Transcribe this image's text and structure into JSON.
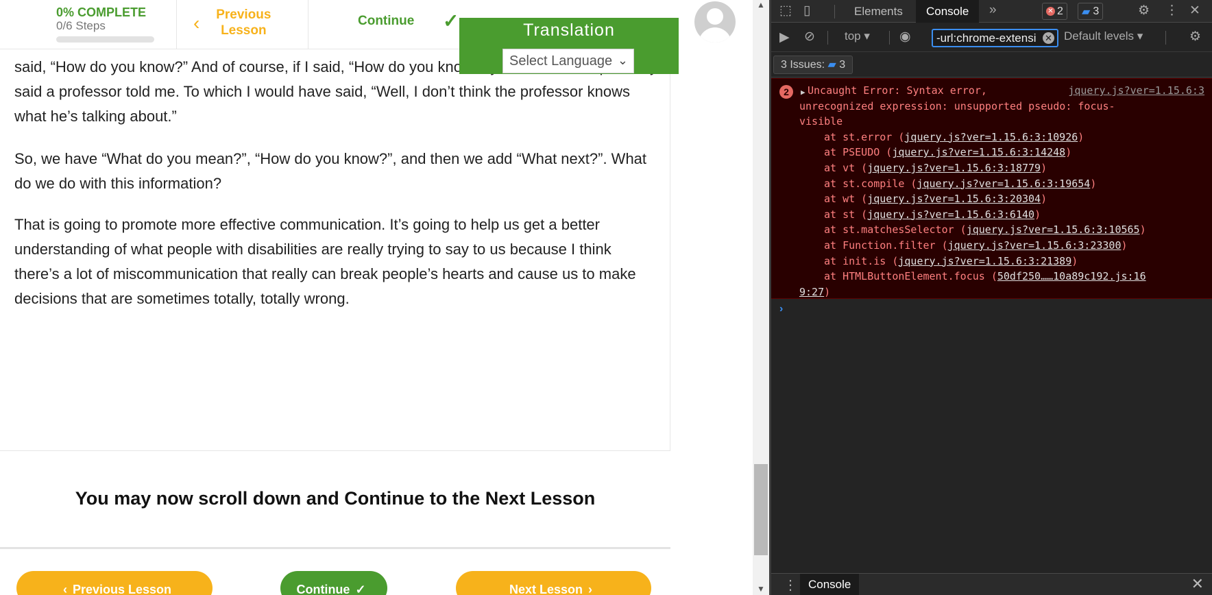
{
  "header": {
    "progress_label": "0% COMPLETE",
    "steps_label": "0/6 Steps",
    "progress_value": 0,
    "previous_lesson_label": "Previous Lesson",
    "continue_label": "Continue"
  },
  "translation": {
    "title": "Translation",
    "select_value": "Select Language"
  },
  "content": {
    "paragraphs": [
      "said, “How do you know?” And of course, if I said, “How do you know?” you would have probably said a professor told me. To which I would have said, “Well, I don’t think the professor knows what he’s talking about.”",
      "So, we have “What do you mean?”, “How do you know?”, and then we add “What next?”. What do we do with this information?",
      "That is going to promote more effective communication. It’s going to help us get a better understanding of what people with disabilities are really trying to say to us because I think there’s a lot of miscommunication that really can break people’s hearts and cause us to make decisions that are sometimes totally, totally wrong."
    ],
    "notice": "You may now scroll down and Continue to the Next Lesson"
  },
  "footer_buttons": {
    "previous": "Previous Lesson",
    "continue": "Continue",
    "next": "Next Lesson"
  },
  "devtools": {
    "tabs": [
      "Elements",
      "Console"
    ],
    "active_tab": "Console",
    "error_count": "2",
    "message_count": "3",
    "context": "top",
    "filter_value": "-url:chrome-extensi",
    "levels": "Default levels",
    "issues_label": "3 Issues:",
    "issues_count": "3",
    "error": {
      "count": "2",
      "message_line1": "Uncaught Error: Syntax error,",
      "message_line2": "unrecognized expression: unsupported pseudo: focus-",
      "message_line3": "visible",
      "source": "jquery.js?ver=1.15.6:3",
      "trace": [
        {
          "prefix": "at st.error (",
          "link": "jquery.js?ver=1.15.6:3:10926",
          "suffix": ")"
        },
        {
          "prefix": "at PSEUDO (",
          "link": "jquery.js?ver=1.15.6:3:14248",
          "suffix": ")"
        },
        {
          "prefix": "at vt (",
          "link": "jquery.js?ver=1.15.6:3:18779",
          "suffix": ")"
        },
        {
          "prefix": "at st.compile (",
          "link": "jquery.js?ver=1.15.6:3:19654",
          "suffix": ")"
        },
        {
          "prefix": "at wt (",
          "link": "jquery.js?ver=1.15.6:3:20304",
          "suffix": ")"
        },
        {
          "prefix": "at st (",
          "link": "jquery.js?ver=1.15.6:3:6140",
          "suffix": ")"
        },
        {
          "prefix": "at st.matchesSelector (",
          "link": "jquery.js?ver=1.15.6:3:10565",
          "suffix": ")"
        },
        {
          "prefix": "at Function.filter (",
          "link": "jquery.js?ver=1.15.6:3:23300",
          "suffix": ")"
        },
        {
          "prefix": "at init.is (",
          "link": "jquery.js?ver=1.15.6:3:21389",
          "suffix": ")"
        },
        {
          "prefix": "at HTMLButtonElement.focus (",
          "link": "50df250……10a89c192.js:16",
          "suffix": ""
        }
      ],
      "trace_tail_link": "9:27",
      "trace_tail_suffix": ")"
    },
    "drawer_tab": "Console"
  },
  "colors": {
    "brand_green": "#4a9c2f",
    "brand_yellow": "#f7b21b",
    "devtools_bg": "#242424",
    "error_bg": "#290000",
    "error_text": "#ff8080"
  }
}
